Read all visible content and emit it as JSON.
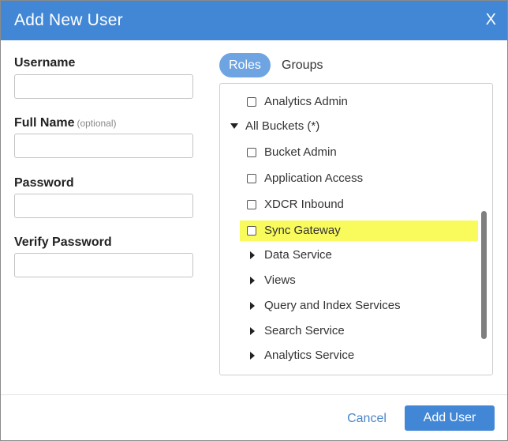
{
  "dialog": {
    "title": "Add New User",
    "close_label": "X"
  },
  "form": {
    "username_label": "Username",
    "username_value": "",
    "fullname_label": "Full Name",
    "fullname_optional": "(optional)",
    "fullname_value": "",
    "password_label": "Password",
    "password_value": "",
    "verify_label": "Verify Password",
    "verify_value": ""
  },
  "tabs": [
    {
      "label": "Roles",
      "active": true
    },
    {
      "label": "Groups",
      "active": false
    }
  ],
  "roles": {
    "items": [
      {
        "label": "Analytics Admin",
        "kind": "checkbox",
        "checked": false,
        "level": 1
      },
      {
        "label": "All Buckets (*)",
        "kind": "expanded",
        "level": 0
      },
      {
        "label": "Bucket Admin",
        "kind": "checkbox",
        "checked": false,
        "level": 1
      },
      {
        "label": "Application Access",
        "kind": "checkbox",
        "checked": false,
        "level": 1
      },
      {
        "label": "XDCR Inbound",
        "kind": "checkbox",
        "checked": false,
        "level": 1
      },
      {
        "label": "Sync Gateway",
        "kind": "checkbox",
        "checked": false,
        "level": 1,
        "highlighted": true
      },
      {
        "label": "Data Service",
        "kind": "collapsed",
        "level": 1
      },
      {
        "label": "Views",
        "kind": "collapsed",
        "level": 1
      },
      {
        "label": "Query and Index Services",
        "kind": "collapsed",
        "level": 1
      },
      {
        "label": "Search Service",
        "kind": "collapsed",
        "level": 1
      },
      {
        "label": "Analytics Service",
        "kind": "collapsed",
        "level": 1
      }
    ],
    "highlight_color": "#f9fa5b"
  },
  "footer": {
    "cancel_label": "Cancel",
    "submit_label": "Add User"
  },
  "colors": {
    "accent": "#4287d6",
    "tab_active": "#6ea4e2",
    "link": "#4a86c8"
  }
}
